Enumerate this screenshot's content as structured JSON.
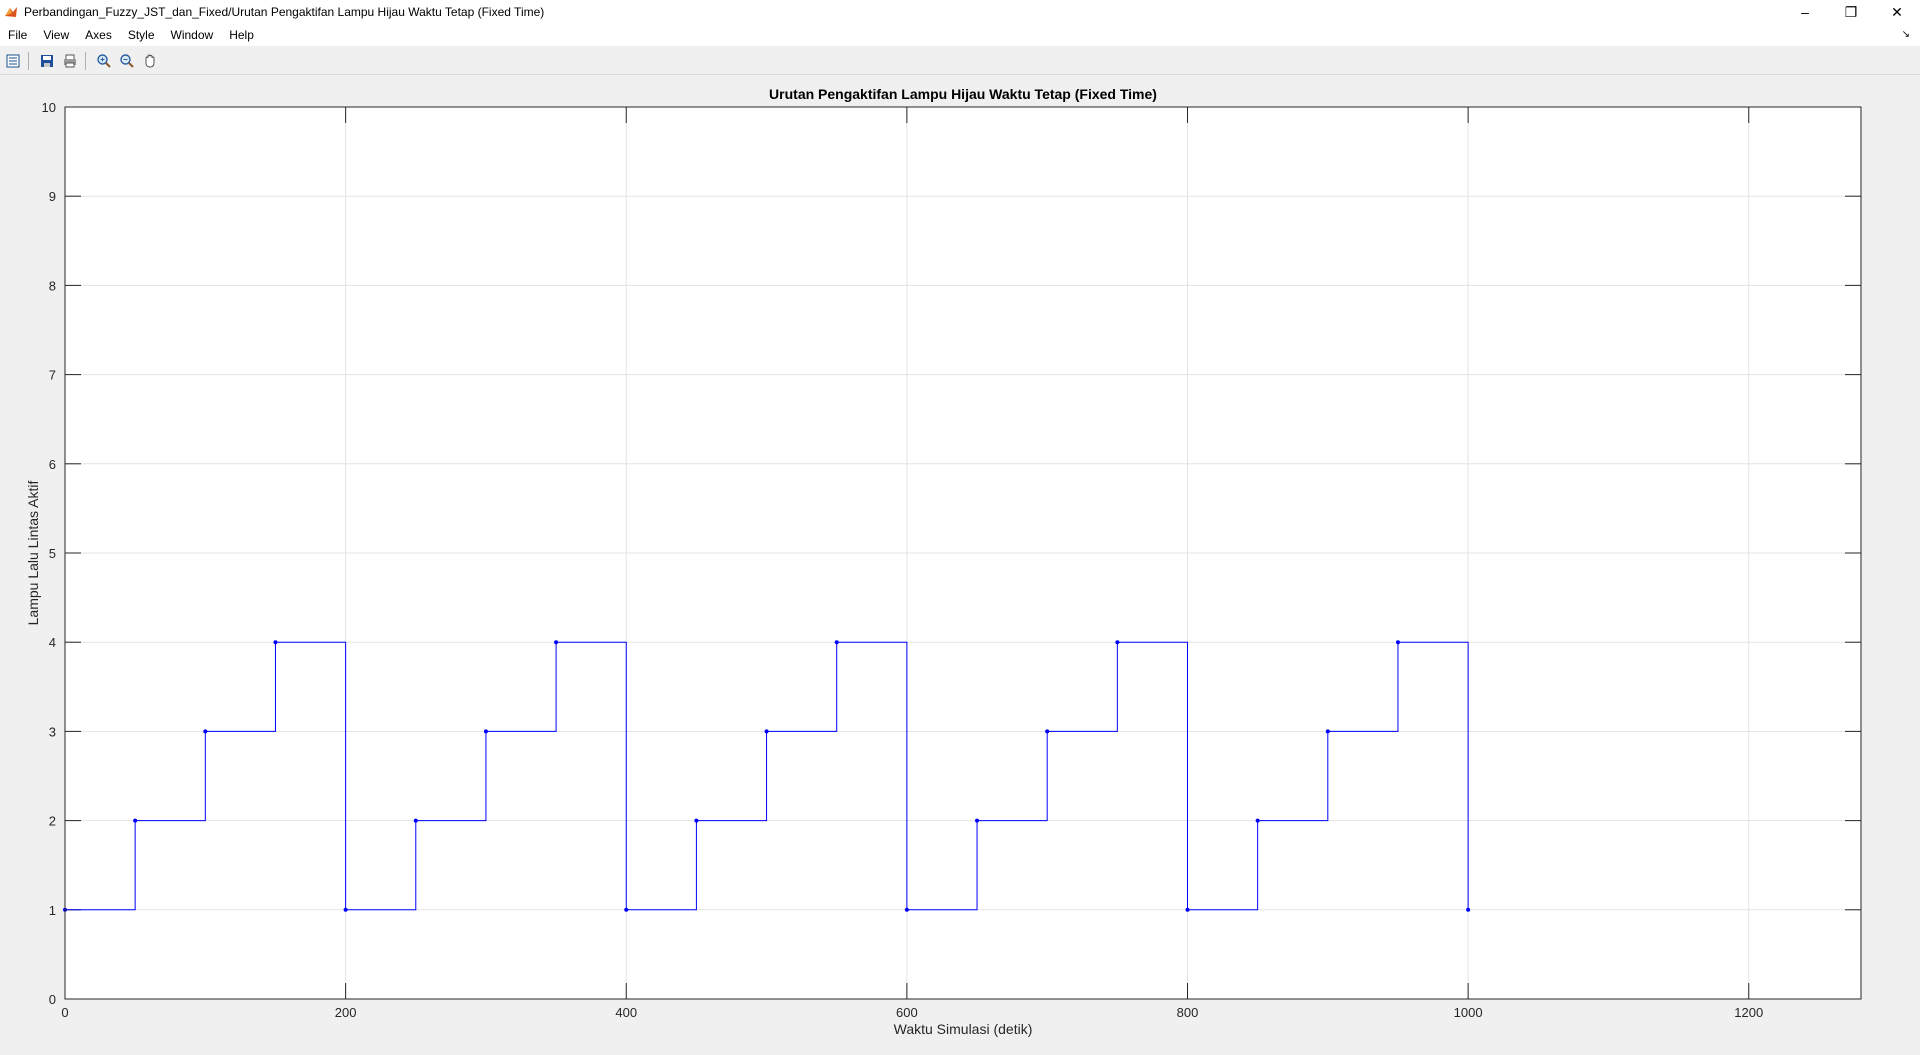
{
  "window": {
    "title": "Perbandingan_Fuzzy_JST_dan_Fixed/Urutan Pengaktifan  Lampu Hijau Waktu Tetap  (Fixed Time)",
    "minimize": "–",
    "restore": "❐",
    "close": "✕"
  },
  "menu": {
    "items": [
      "File",
      "View",
      "Axes",
      "Style",
      "Window",
      "Help"
    ],
    "dock_arrow": "↘"
  },
  "toolbar": {
    "icons": [
      "parameters-icon",
      "save-icon",
      "print-icon",
      "zoom-in-icon",
      "zoom-out-icon",
      "pan-icon"
    ]
  },
  "chart_data": {
    "type": "line",
    "line_style": "stairs with point markers",
    "title": "Urutan Pengaktifan Lampu Hijau Waktu Tetap (Fixed Time)",
    "xlabel": "Waktu Simulasi (detik)",
    "ylabel": "Lampu Lalu Lintas Aktif",
    "xlim": [
      0,
      1280
    ],
    "ylim": [
      0,
      10
    ],
    "xticks": [
      0,
      200,
      400,
      600,
      800,
      1000,
      1200
    ],
    "yticks": [
      0,
      1,
      2,
      3,
      4,
      5,
      6,
      7,
      8,
      9,
      10
    ],
    "grid": true,
    "color": "#0000ff",
    "series": [
      {
        "x": [
          0,
          50,
          100,
          150,
          200,
          250,
          300,
          350,
          400,
          450,
          500,
          550,
          600,
          650,
          700,
          750,
          800,
          850,
          900,
          950,
          1000
        ],
        "y": [
          1,
          2,
          3,
          4,
          1,
          2,
          3,
          4,
          1,
          2,
          3,
          4,
          1,
          2,
          3,
          4,
          1,
          2,
          3,
          4,
          1
        ]
      }
    ]
  }
}
